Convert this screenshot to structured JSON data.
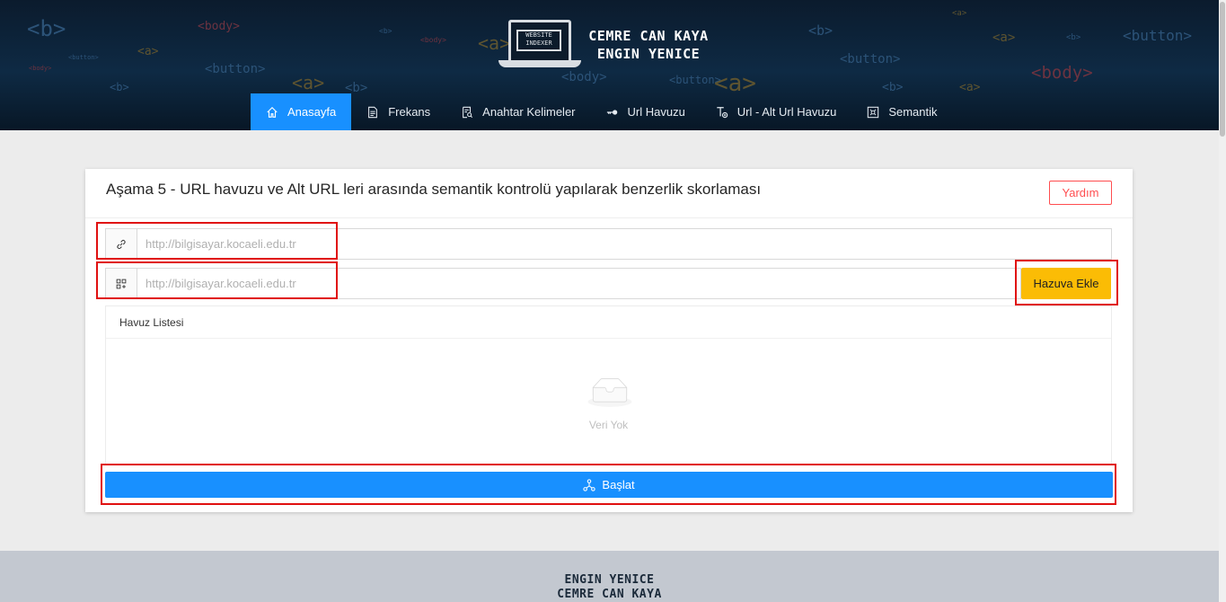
{
  "header": {
    "logo_text": "WEBSITE INDEXER",
    "author_names": [
      "CEMRE CAN KAYA",
      "ENGIN YENICE"
    ],
    "decorations": [
      "<b>",
      "<body>",
      "<a>",
      "<button>",
      "<b>",
      "<body>",
      "<a>",
      "<button>",
      "<a>",
      "<b>",
      "<body>",
      "<button>",
      "<a>",
      "<body>",
      "<b>",
      "<a>",
      "<button>",
      "<b>",
      "<a>",
      "<body>",
      "<b>",
      "<a>",
      "<button>",
      "<b>"
    ]
  },
  "nav": {
    "items": [
      {
        "label": "Anasayfa",
        "icon": "home-icon",
        "active": true
      },
      {
        "label": "Frekans",
        "icon": "file-icon",
        "active": false
      },
      {
        "label": "Anahtar Kelimeler",
        "icon": "file-search-icon",
        "active": false
      },
      {
        "label": "Url Havuzu",
        "icon": "key-icon",
        "active": false
      },
      {
        "label": "Url - Alt Url Havuzu",
        "icon": "text-add-icon",
        "active": false
      },
      {
        "label": "Semantik",
        "icon": "command-icon",
        "active": false
      }
    ]
  },
  "card": {
    "title": "Aşama 5 - URL havuzu ve Alt URL leri arasında semantik kontrolü yapılarak benzerlik skorlaması",
    "help_label": "Yardım",
    "url_input": {
      "placeholder": "http://bilgisayar.kocaeli.edu.tr",
      "value": "",
      "icon": "link-icon"
    },
    "sub_url_input": {
      "placeholder": "http://bilgisayar.kocaeli.edu.tr",
      "value": "",
      "icon": "appstore-add-icon"
    },
    "add_label": "Hazuva Ekle",
    "pool": {
      "title": "Havuz Listesi",
      "empty_text": "Veri Yok"
    },
    "start_label": "Başlat"
  },
  "footer": {
    "names": [
      "ENGIN YENICE",
      "CEMRE CAN KAYA"
    ]
  },
  "colors": {
    "primary": "#1890ff",
    "warning": "#fbbc05",
    "danger": "#ff4d4f",
    "header_bg": "#0e2a44",
    "highlight": "#e01010"
  }
}
